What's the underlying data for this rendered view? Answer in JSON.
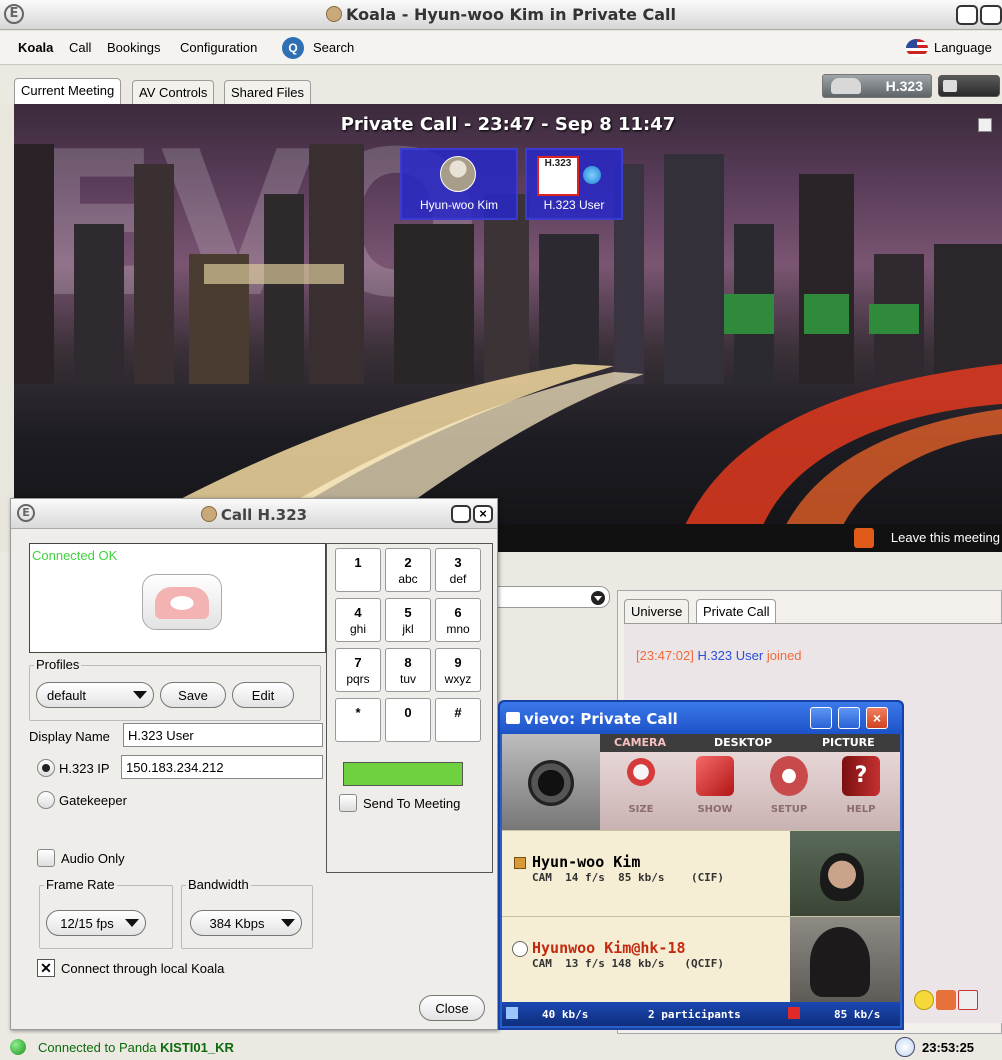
{
  "window": {
    "title": "Koala - Hyun-woo Kim in Private Call"
  },
  "menu": {
    "app": "Koala",
    "items": [
      "Call",
      "Bookings",
      "Configuration"
    ],
    "search": "Search",
    "language": "Language"
  },
  "tabs": [
    "Current Meeting",
    "AV Controls",
    "Shared Files"
  ],
  "h323_badge": "H.323",
  "meeting": {
    "title": "Private Call - 23:47 - Sep 8 11:47",
    "participants": [
      "Hyun-woo Kim",
      "H.323 User"
    ],
    "h323_icon_text": "H.323",
    "leave": "Leave this meeting"
  },
  "chat": {
    "tabs": [
      "Universe",
      "Private Call"
    ],
    "line": {
      "time": "[23:47:02]",
      "user": "H.323 User",
      "action": "joined"
    }
  },
  "call_dialog": {
    "title": "Call H.323",
    "status": "Connected OK",
    "profiles_label": "Profiles",
    "profile_value": "default",
    "save": "Save",
    "edit": "Edit",
    "display_name_label": "Display Name",
    "display_name_value": "H.323 User",
    "h323_ip_label": "H.323 IP",
    "h323_ip_value": "150.183.234.212",
    "gatekeeper_label": "Gatekeeper",
    "audio_only_label": "Audio Only",
    "frame_rate_label": "Frame Rate",
    "frame_rate_value": "12/15 fps",
    "bandwidth_label": "Bandwidth",
    "bandwidth_value": "384 Kbps",
    "connect_local_label": "Connect through local Koala",
    "connect_local_checked": true,
    "send_to_meeting_label": "Send To Meeting",
    "close": "Close",
    "keys": [
      {
        "d": "1",
        "l": ""
      },
      {
        "d": "2",
        "l": "abc"
      },
      {
        "d": "3",
        "l": "def"
      },
      {
        "d": "4",
        "l": "ghi"
      },
      {
        "d": "5",
        "l": "jkl"
      },
      {
        "d": "6",
        "l": "mno"
      },
      {
        "d": "7",
        "l": "pqrs"
      },
      {
        "d": "8",
        "l": "tuv"
      },
      {
        "d": "9",
        "l": "wxyz"
      },
      {
        "d": "*",
        "l": ""
      },
      {
        "d": "0",
        "l": ""
      },
      {
        "d": "#",
        "l": ""
      }
    ]
  },
  "vievo": {
    "title": "vievo: Private Call",
    "tabs": [
      "CAMERA",
      "DESKTOP",
      "PICTURE"
    ],
    "tools": [
      "SIZE",
      "SHOW",
      "SETUP",
      "HELP"
    ],
    "participants": [
      {
        "name": "Hyun-woo Kim",
        "stats": "CAM  14 f/s  85 kb/s    (CIF)",
        "color": "#000000"
      },
      {
        "name": "Hyunwoo Kim@hk-18",
        "stats": "CAM  13 f/s 148 kb/s   (QCIF)",
        "color": "#c42a10"
      }
    ],
    "status_left": "40 kb/s",
    "status_mid": "2 participants",
    "status_right": "85 kb/s"
  },
  "statusbar": {
    "prefix": "Connected to Panda",
    "server": "KISTI01_KR",
    "time": "23:53:25"
  }
}
